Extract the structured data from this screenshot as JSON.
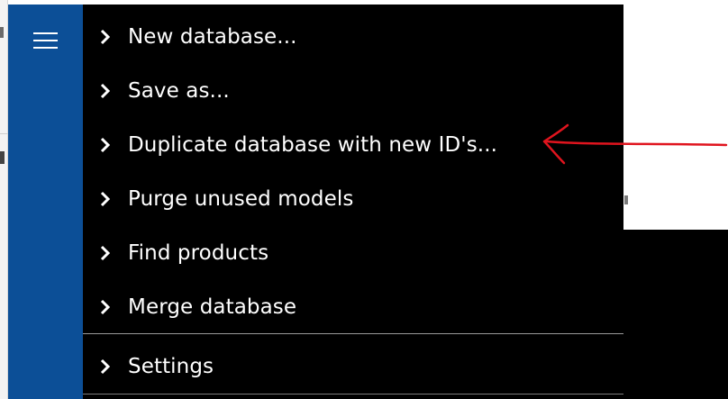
{
  "menu": {
    "items": [
      {
        "label": "New database..."
      },
      {
        "label": "Save as..."
      },
      {
        "label": "Duplicate database with new ID's..."
      },
      {
        "label": "Purge unused models"
      },
      {
        "label": "Find products"
      },
      {
        "label": "Merge database"
      }
    ],
    "footer_items": [
      {
        "label": "Settings"
      }
    ]
  },
  "colors": {
    "rail": "#0c4f97",
    "menu_background": "#000000",
    "menu_text": "#ffffff",
    "annotation": "#e0141e"
  },
  "icons": {
    "hamburger": "hamburger-menu-icon",
    "chevron": "chevron-right-icon",
    "annotation": "red-arrow-annotation"
  }
}
